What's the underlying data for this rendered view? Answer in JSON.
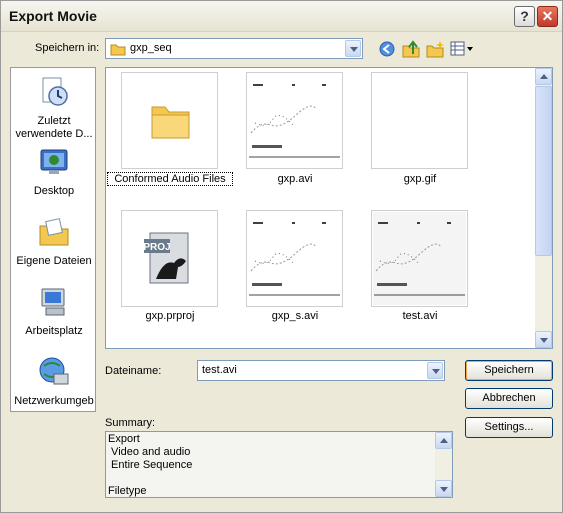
{
  "window": {
    "title": "Export Movie"
  },
  "title_buttons": {
    "help": "?",
    "close": "✕"
  },
  "location": {
    "label": "Speichern in:",
    "value": "gxp_seq"
  },
  "places": [
    {
      "label": "Zuletzt verwendete D...",
      "icon": "recent-documents-icon"
    },
    {
      "label": "Desktop",
      "icon": "desktop-icon"
    },
    {
      "label": "Eigene Dateien",
      "icon": "my-documents-icon"
    },
    {
      "label": "Arbeitsplatz",
      "icon": "my-computer-icon"
    },
    {
      "label": "Netzwerkumgeb",
      "icon": "network-icon"
    }
  ],
  "files": [
    {
      "name": "Conformed Audio Files",
      "kind": "folder"
    },
    {
      "name": "gxp.avi",
      "kind": "video"
    },
    {
      "name": "gxp.gif",
      "kind": "image"
    },
    {
      "name": "gxp.prproj",
      "kind": "project"
    },
    {
      "name": "gxp_s.avi",
      "kind": "video"
    },
    {
      "name": "test.avi",
      "kind": "video"
    }
  ],
  "filename": {
    "label": "Dateiname:",
    "value": "test.avi"
  },
  "buttons": {
    "save": "Speichern",
    "cancel": "Abbrechen",
    "settings": "Settings..."
  },
  "summary": {
    "label": "Summary:",
    "lines": [
      "Export",
      " Video and audio",
      " Entire Sequence",
      "",
      "Filetype"
    ]
  },
  "colors": {
    "accent": "#0a246a",
    "folder": "#f3c750",
    "window_bg": "#ece9d8"
  }
}
